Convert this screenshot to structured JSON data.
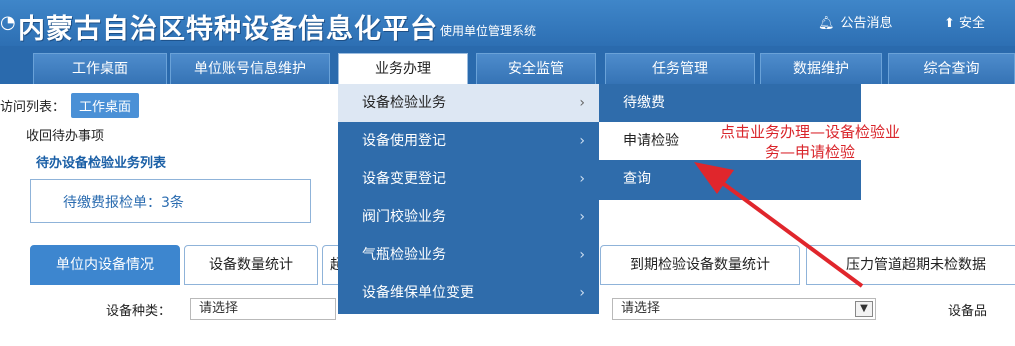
{
  "header": {
    "title": "内蒙古自治区特种设备信息化平台",
    "subtitle": "使用单位管理系统",
    "notice_icon": "bell-icon",
    "notice_label": "公告消息",
    "safe_icon": "upload-icon",
    "safe_label": "安全"
  },
  "nav": {
    "items": [
      {
        "label": "工作桌面"
      },
      {
        "label": "单位账号信息维护"
      },
      {
        "label": "业务办理"
      },
      {
        "label": "安全监管"
      },
      {
        "label": "任务管理"
      },
      {
        "label": "数据维护"
      },
      {
        "label": "综合查询"
      }
    ]
  },
  "breadcrumb": {
    "label": "访问列表：",
    "current": "工作桌面"
  },
  "todo": {
    "heading": "收回待办事项",
    "list_title": "待办设备检验业务列表",
    "item": "待缴费报检单：3条"
  },
  "tabs": [
    {
      "label": "单位内设备情况"
    },
    {
      "label": "设备数量统计"
    },
    {
      "label": "超"
    },
    {
      "label": "到期检验设备数量统计"
    },
    {
      "label": "压力管道超期未检数据"
    }
  ],
  "filters": {
    "device_type_label": "设备种类：",
    "device_type_value": "请选择",
    "second_value": "请选择",
    "right_label": "设备品"
  },
  "menu": {
    "items": [
      {
        "label": "设备检验业务"
      },
      {
        "label": "设备使用登记"
      },
      {
        "label": "设备变更登记"
      },
      {
        "label": "阀门校验业务"
      },
      {
        "label": "气瓶检验业务"
      },
      {
        "label": "设备维保单位变更"
      }
    ],
    "chevron": "›"
  },
  "submenu": {
    "items": [
      {
        "label": "待缴费"
      },
      {
        "label": "申请检验"
      },
      {
        "label": "查询"
      }
    ]
  },
  "annotation": {
    "line1": "点击业务办理—设备检验业",
    "line2": "务—申请检验"
  },
  "colors": {
    "header_blue": "#3f86c9",
    "menu_blue": "#2f6cab",
    "annotation_red": "#d9262c"
  }
}
